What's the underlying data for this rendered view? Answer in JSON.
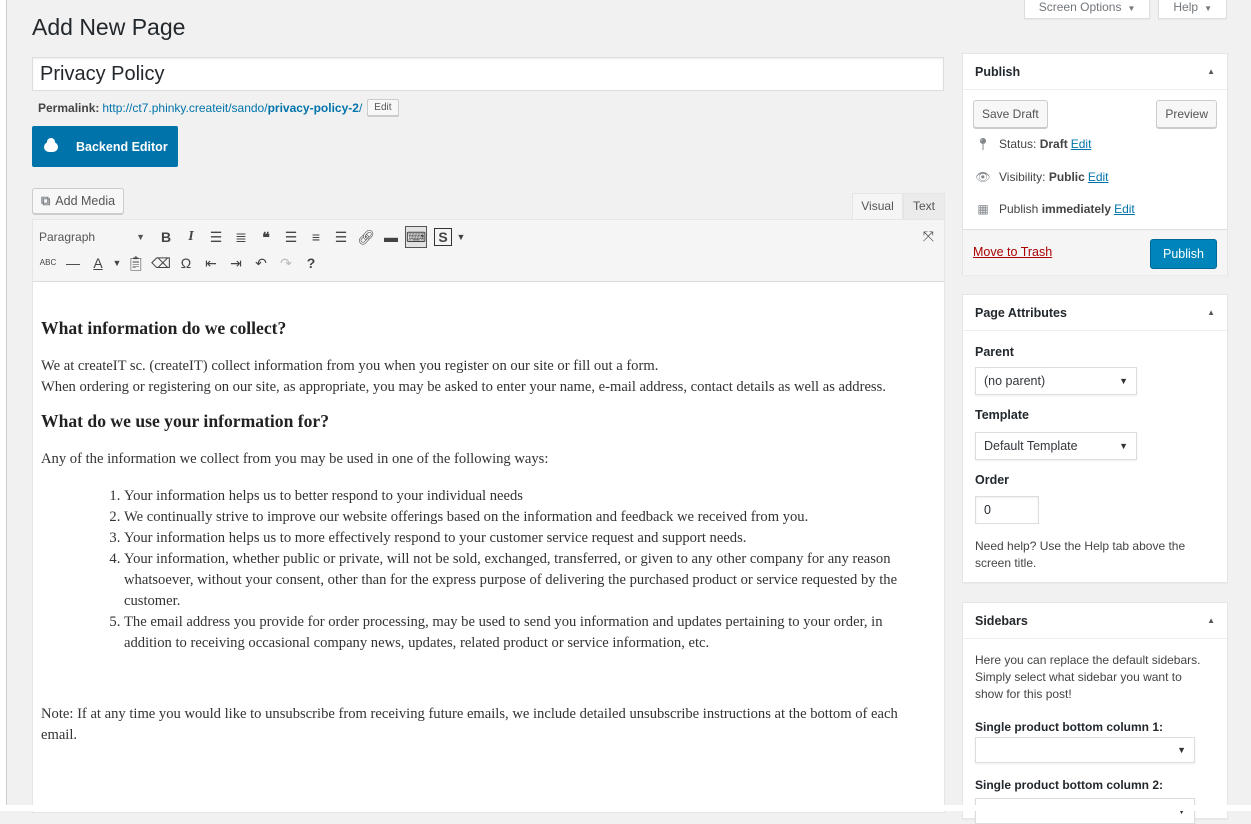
{
  "screen_meta": {
    "screen_options": "Screen Options",
    "help": "Help"
  },
  "page_title": "Add New Page",
  "post_title": "Privacy Policy",
  "permalink": {
    "label": "Permalink:",
    "base": "http://ct7.phinky.createit/sando/",
    "slug": "privacy-policy-2",
    "trail": "/",
    "edit": "Edit"
  },
  "backend_editor": "Backend Editor",
  "add_media": "Add Media",
  "tabs": {
    "visual": "Visual",
    "text": "Text"
  },
  "toolbar": {
    "format": "Paragraph"
  },
  "content": {
    "h1": "What information do we collect?",
    "p1": "We at createIT sc. (createIT) collect information from you when you register on our site or fill out a form.",
    "p2": "When ordering or registering on our site, as appropriate, you may be asked to enter your name, e-mail address, contact details as well as address.",
    "h2": "What do we use your information for?",
    "p3": "Any of the information we collect from you may be used in one of the following ways:",
    "list": [
      "Your information helps us to better respond to your individual needs",
      "We continually strive to improve our website offerings based on the information and feedback we received from you.",
      "Your information helps us to more effectively respond to your customer service request and support needs.",
      "Your information, whether public or private, will not be sold, exchanged, transferred, or given to any other company for any reason whatsoever, without your consent, other than for the express purpose of delivering the purchased product or service requested by the customer.",
      "The email address you provide for order processing, may be used to send you information and updates pertaining to your order, in addition to receiving occasional company news, updates, related product or service information, etc."
    ],
    "note": "Note: If at any time you would like to unsubscribe from receiving future emails, we include detailed unsubscribe instructions at the bottom of each email."
  },
  "publish": {
    "title": "Publish",
    "save_draft": "Save Draft",
    "preview": "Preview",
    "status_label": "Status:",
    "status_value": "Draft",
    "visibility_label": "Visibility:",
    "visibility_value": "Public",
    "publish_label": "Publish",
    "publish_value": "immediately",
    "edit": "Edit",
    "move_to_trash": "Move to Trash",
    "publish_button": "Publish"
  },
  "page_attributes": {
    "title": "Page Attributes",
    "parent_label": "Parent",
    "parent_value": "(no parent)",
    "template_label": "Template",
    "template_value": "Default Template",
    "order_label": "Order",
    "order_value": "0",
    "help": "Need help? Use the Help tab above the screen title."
  },
  "sidebars": {
    "title": "Sidebars",
    "desc": "Here you can replace the default sidebars. Simply select what sidebar you want to show for this post!",
    "col1_label": "Single product bottom column 1:",
    "col2_label": "Single product bottom column 2:"
  }
}
